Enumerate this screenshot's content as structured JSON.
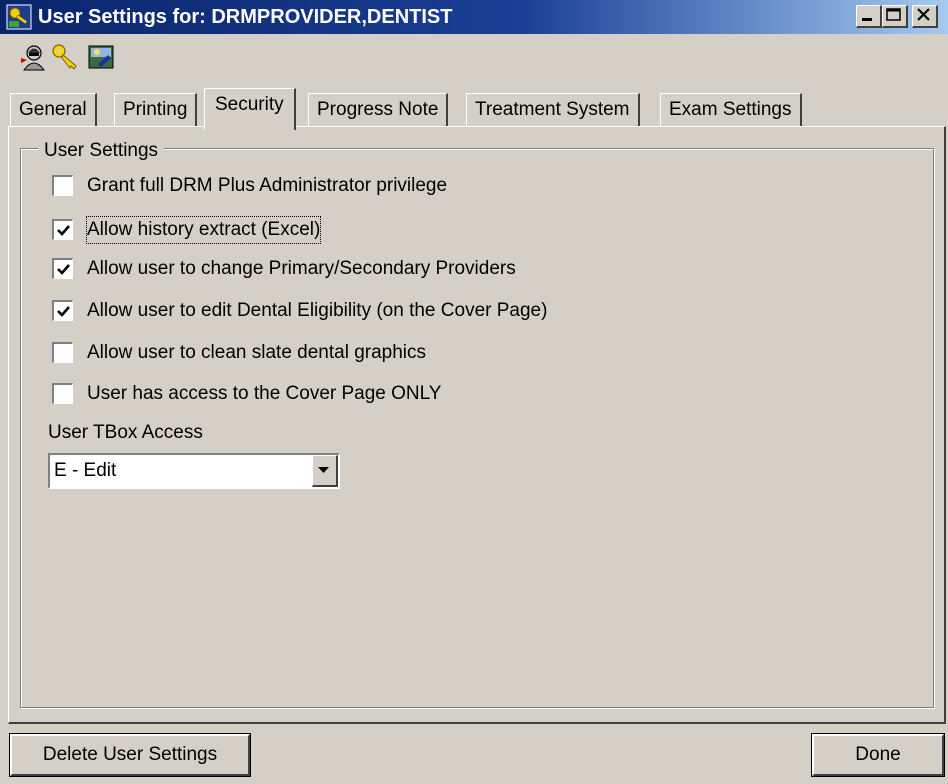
{
  "window": {
    "title": "User Settings for: DRMPROVIDER,DENTIST",
    "buttons": [
      "minimize-icon",
      "maximize-icon",
      "close-icon"
    ]
  },
  "toolbar": {
    "icons": [
      "user-icon",
      "key-icon",
      "image-icon"
    ]
  },
  "tabs": [
    {
      "label": "General",
      "active": false
    },
    {
      "label": "Printing",
      "active": false
    },
    {
      "label": "Security",
      "active": true
    },
    {
      "label": "Progress Note",
      "active": false
    },
    {
      "label": "Treatment System",
      "active": false
    },
    {
      "label": "Exam Settings",
      "active": false
    }
  ],
  "group": {
    "title": "User Settings",
    "checkboxes": [
      {
        "label": "Grant full DRM Plus Administrator privilege",
        "checked": false
      },
      {
        "label": "Allow history extract (Excel)",
        "checked": true,
        "focused": true
      },
      {
        "label": "Allow user to change Primary/Secondary Providers",
        "checked": true
      },
      {
        "label": "Allow user to edit Dental Eligibility (on the Cover Page)",
        "checked": true
      },
      {
        "label": "Allow user to clean slate dental graphics",
        "checked": false
      },
      {
        "label": "User has access to the Cover Page ONLY",
        "checked": false
      }
    ],
    "tbox_label": "User TBox Access",
    "tbox_value": "E - Edit"
  },
  "footer": {
    "delete_label": "Delete User Settings",
    "done_label": "Done"
  }
}
